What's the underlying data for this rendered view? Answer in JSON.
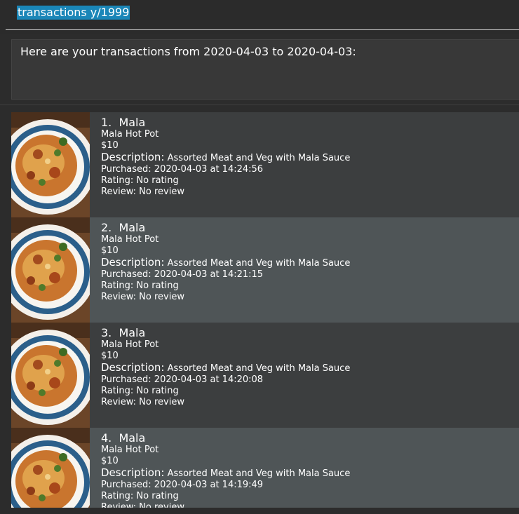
{
  "command": {
    "text": "transactions y/1999"
  },
  "result": {
    "text": "Here are your transactions from 2020-04-03 to 2020-04-03:"
  },
  "transactions": [
    {
      "index": "1.",
      "name": "Mala",
      "variant": "Mala Hot Pot",
      "price": "$10",
      "description_label": "Description:",
      "description": "Assorted Meat and Veg with Mala Sauce",
      "purchased": "Purchased: 2020-04-03 at 14:24:56",
      "rating": "Rating: No rating",
      "review": "Review: No review"
    },
    {
      "index": "2.",
      "name": "Mala",
      "variant": "Mala Hot Pot",
      "price": "$10",
      "description_label": "Description:",
      "description": "Assorted Meat and Veg with Mala Sauce",
      "purchased": "Purchased: 2020-04-03 at 14:21:15",
      "rating": "Rating: No rating",
      "review": "Review: No review"
    },
    {
      "index": "3.",
      "name": "Mala",
      "variant": "Mala Hot Pot",
      "price": "$10",
      "description_label": "Description:",
      "description": "Assorted Meat and Veg with Mala Sauce",
      "purchased": "Purchased: 2020-04-03 at 14:20:08",
      "rating": "Rating: No rating",
      "review": "Review: No review"
    },
    {
      "index": "4.",
      "name": "Mala",
      "variant": "Mala Hot Pot",
      "price": "$10",
      "description_label": "Description:",
      "description": "Assorted Meat and Veg with Mala Sauce",
      "purchased": "Purchased: 2020-04-03 at 14:19:49",
      "rating": "Rating: No rating",
      "review": "Review: No review"
    }
  ],
  "colors": {
    "selection": "#1a86b8",
    "row_dark": "#3c3e3f",
    "row_light": "#4f5557"
  }
}
